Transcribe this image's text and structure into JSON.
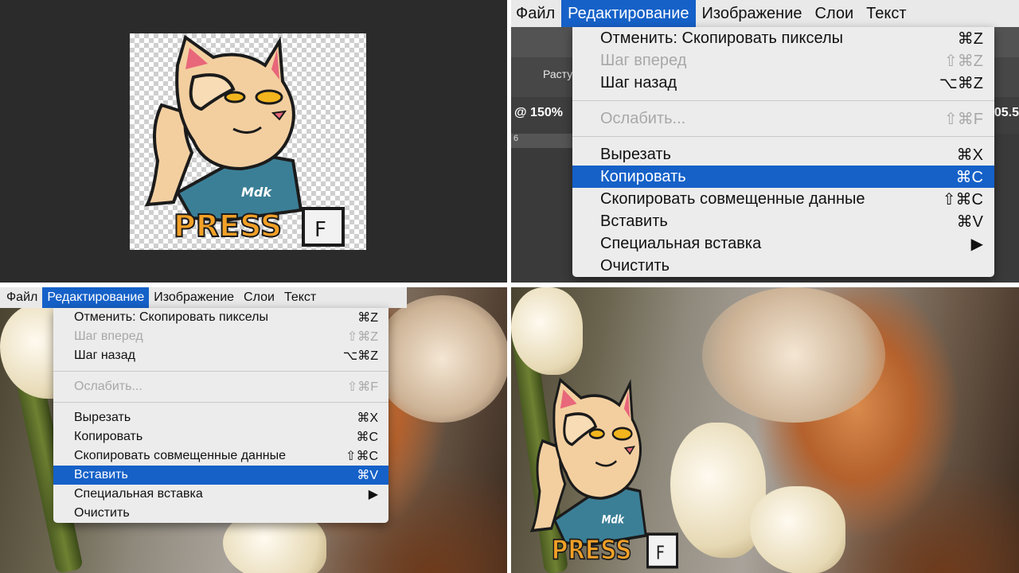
{
  "menubar": {
    "items": [
      "Файл",
      "Редактирование",
      "Изображение",
      "Слои",
      "Текст"
    ]
  },
  "edit_menu": {
    "items": [
      {
        "label": "Отменить: Скопировать пикселы",
        "shortcut": "⌘Z"
      },
      {
        "label": "Шаг вперед",
        "shortcut": "⇧⌘Z"
      },
      {
        "label": "Шаг назад",
        "shortcut": "⌥⌘Z"
      },
      {
        "label": "Ослабить...",
        "shortcut": "⇧⌘F"
      },
      {
        "label": "Вырезать",
        "shortcut": "⌘X"
      },
      {
        "label": "Копировать",
        "shortcut": "⌘C"
      },
      {
        "label": "Скопировать совмещенные данные",
        "shortcut": "⇧⌘C"
      },
      {
        "label": "Вставить",
        "shortcut": "⌘V"
      },
      {
        "label": "Специальная вставка",
        "shortcut": "▶"
      },
      {
        "label": "Очистить",
        "shortcut": ""
      }
    ]
  },
  "photoshop_bg": {
    "zoom": "@ 150%",
    "panel_label": "Расту",
    "right_value": "05.5",
    "ruler": "6"
  },
  "sticker": {
    "press_text": "PRESS",
    "key_letter": "F",
    "shirt_logo": "Mdk"
  },
  "colors": {
    "highlight": "#1561c8",
    "menu_bg": "#ececec",
    "disabled_text": "#a8a8a8",
    "press_orange": "#f2a027"
  },
  "icons": [
    "submenu-arrow-icon"
  ]
}
